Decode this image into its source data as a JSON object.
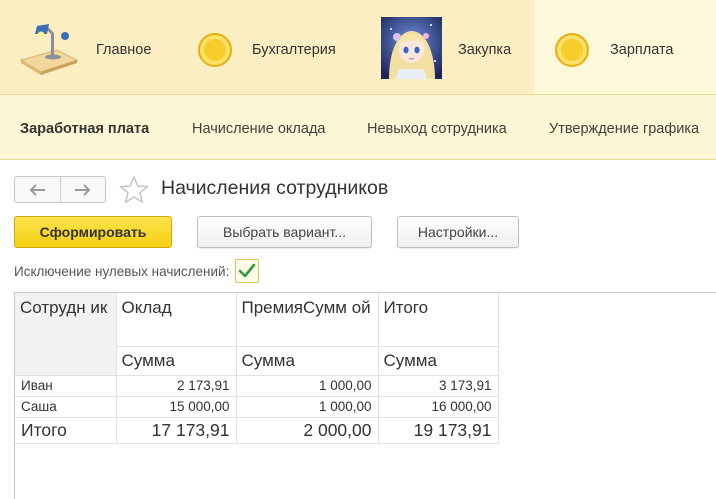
{
  "sections": {
    "main": {
      "label": "Главное",
      "icon": "desk-lamp-icon"
    },
    "accounting": {
      "label": "Бухгалтерия",
      "icon": "coin-icon"
    },
    "purchase": {
      "label": "Закупка",
      "icon": "anime-avatar-picture"
    },
    "salary": {
      "label": "Зарплата",
      "icon": "coin-icon",
      "active": true
    }
  },
  "subnav": {
    "items": [
      {
        "label": "Заработная плата",
        "bold": true
      },
      {
        "label": "Начисление оклада"
      },
      {
        "label": "Невыход сотрудника"
      },
      {
        "label": "Утверждение графика"
      }
    ]
  },
  "form": {
    "title": "Начисления сотрудников",
    "back_icon": "arrow-left-icon",
    "forward_icon": "arrow-right-icon",
    "favorite_icon": "star-outline-icon"
  },
  "commands": {
    "generate": "Сформировать",
    "choose_variant": "Выбрать вариант...",
    "settings": "Настройки..."
  },
  "filter": {
    "label": "Исключение нулевых начислений:",
    "checked": true
  },
  "report": {
    "columns": [
      {
        "name": "Сотрудник",
        "display": "Сотрудн ик",
        "sub": ""
      },
      {
        "name": "Оклад",
        "display": "Оклад",
        "sub": "Сумма"
      },
      {
        "name": "ПремияСуммой",
        "display": "ПремияСумм ой",
        "sub": "Сумма"
      },
      {
        "name": "Итого",
        "display": "Итого",
        "sub": "Сумма"
      }
    ],
    "rows": [
      {
        "employee": "Иван",
        "salary": "2 173,91",
        "bonus": "1 000,00",
        "total": "3 173,91"
      },
      {
        "employee": "Саша",
        "salary": "15 000,00",
        "bonus": "1 000,00",
        "total": "16 000,00"
      }
    ],
    "totals": {
      "label": "Итого",
      "salary": "17 173,91",
      "bonus": "2 000,00",
      "total": "19 173,91"
    }
  },
  "colors": {
    "sections_bg": "#fbeec2",
    "active_section_bg": "#fff9dc",
    "subnav_bg": "#fdf7d5",
    "primary_button": "#f5d40f",
    "check_mark": "#2e9e3a"
  }
}
